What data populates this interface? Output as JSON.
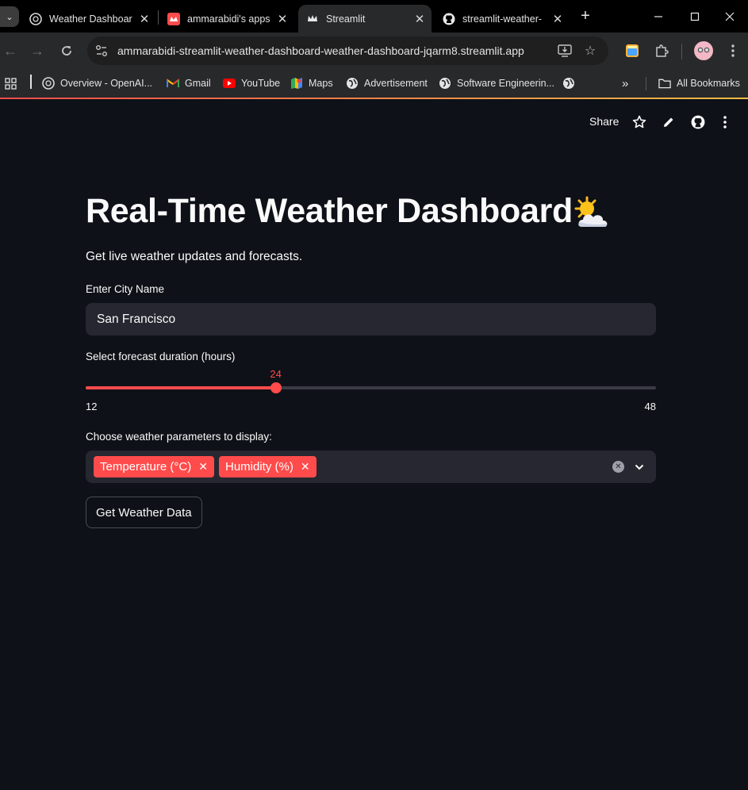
{
  "browser": {
    "tabs": [
      {
        "title": "Weather Dashboar"
      },
      {
        "title": "ammarabidi's apps"
      },
      {
        "title": "Streamlit"
      },
      {
        "title": "streamlit-weather-"
      }
    ],
    "url": "ammarabidi-streamlit-weather-dashboard-weather-dashboard-jqarm8.streamlit.app",
    "bookmarks": [
      {
        "label": "Overview - OpenAI..."
      },
      {
        "label": "Gmail"
      },
      {
        "label": "YouTube"
      },
      {
        "label": "Maps"
      },
      {
        "label": "Advertisement"
      },
      {
        "label": "Software Engineerin..."
      }
    ],
    "all_bookmarks": "All Bookmarks",
    "overflow": "»"
  },
  "header": {
    "share_label": "Share"
  },
  "app": {
    "title": "Real-Time Weather Dashboard",
    "subtitle": "Get live weather updates and forecasts.",
    "city_label": "Enter City Name",
    "city_value": "San Francisco",
    "slider_label": "Select forecast duration (hours)",
    "slider_value": 24,
    "slider_min": 12,
    "slider_max": 48,
    "params_label": "Choose weather parameters to display:",
    "params_selected": [
      "Temperature (°C)",
      "Humidity (%)"
    ],
    "button_label": "Get Weather Data"
  },
  "colors": {
    "primary": "#ff4b4b",
    "background": "#0e1117",
    "widget_bg": "#262730"
  }
}
